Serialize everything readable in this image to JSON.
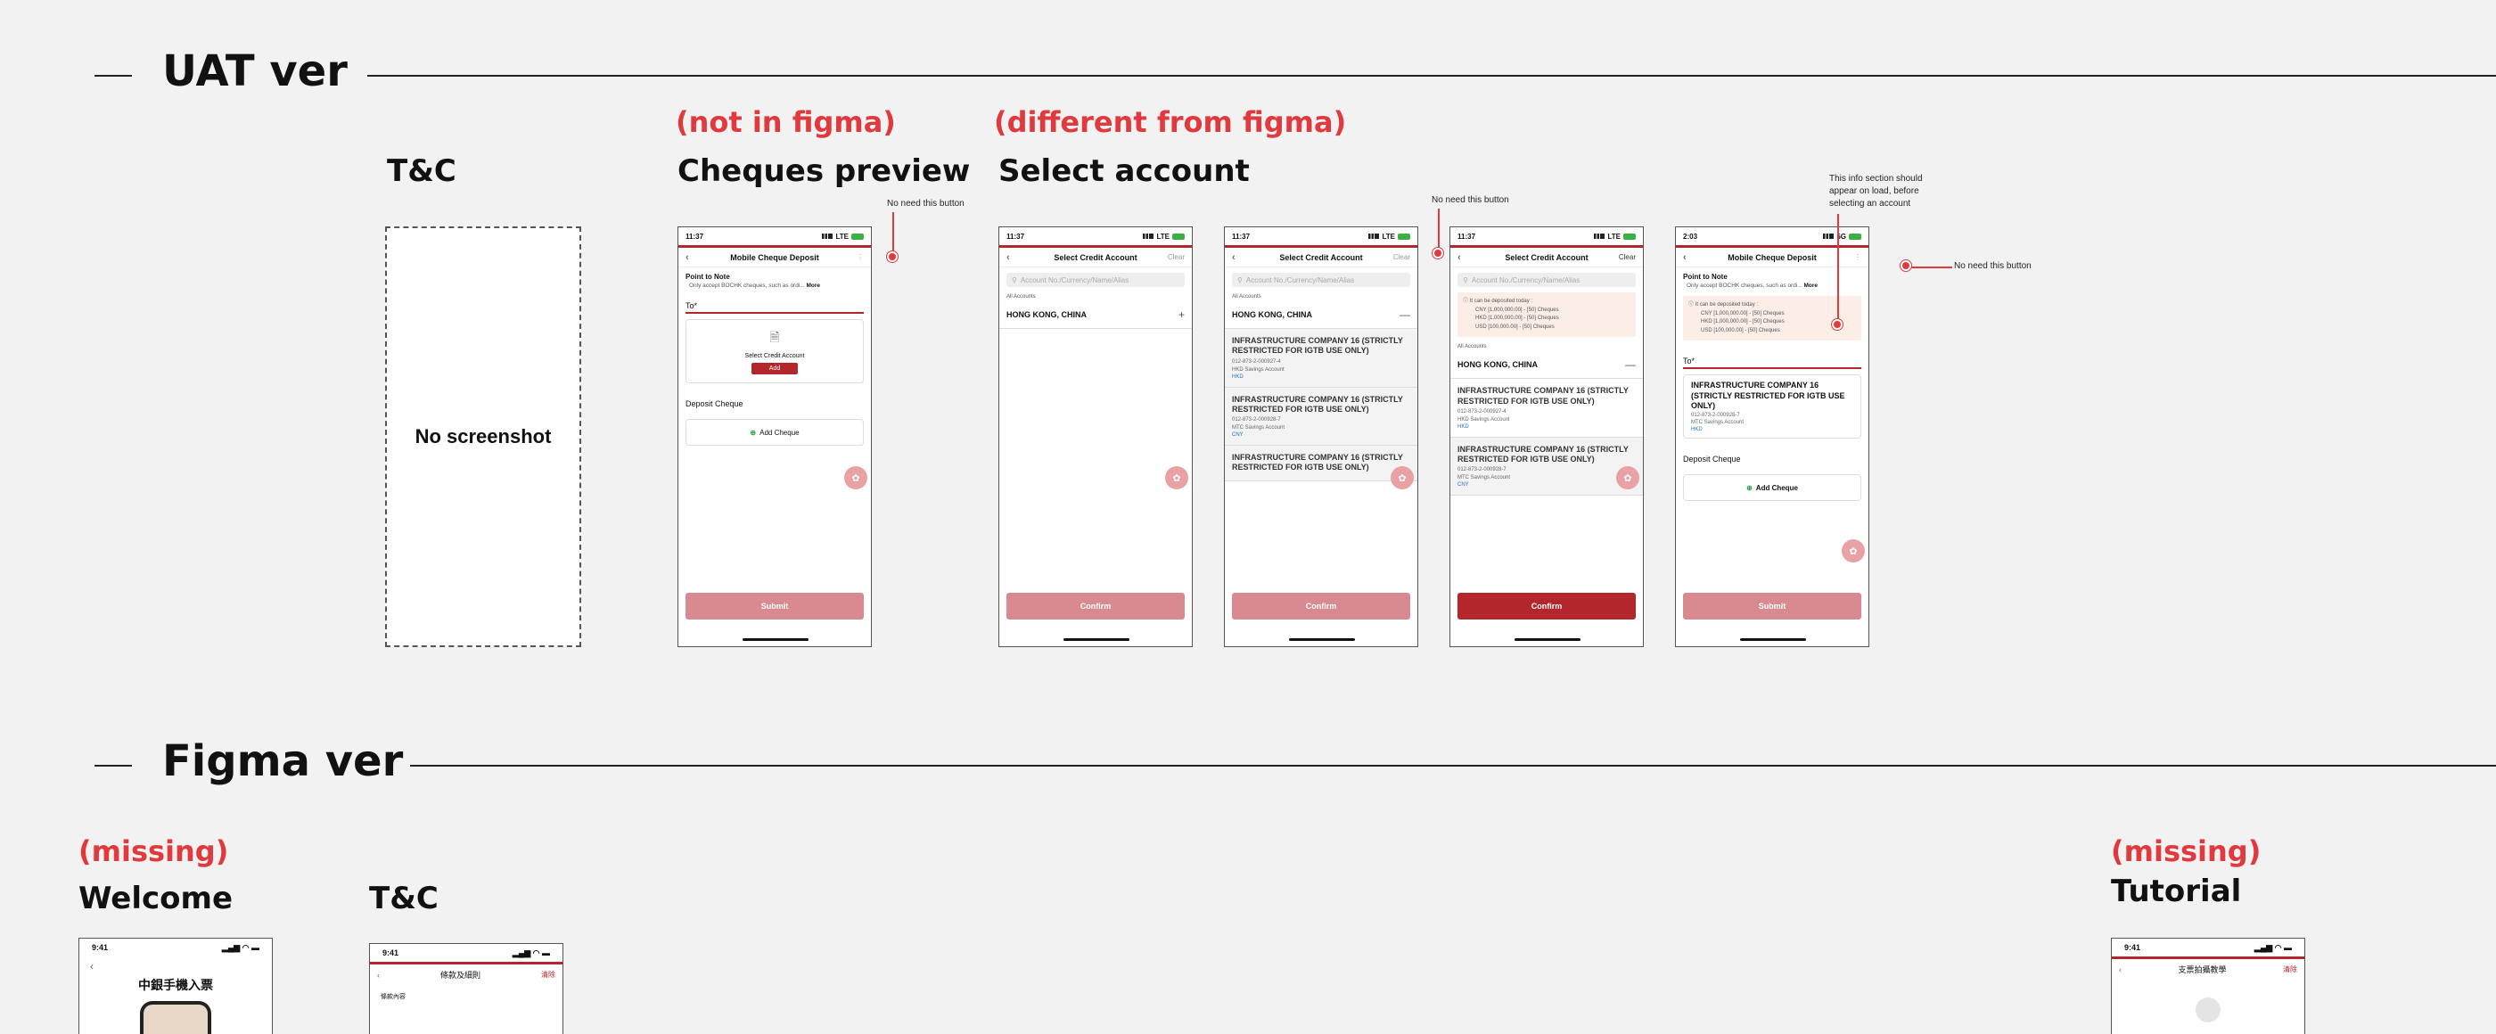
{
  "sections": {
    "uat": {
      "title": "UAT ver"
    },
    "figma": {
      "title": "Figma ver"
    }
  },
  "uat_frames": {
    "tnc": {
      "title": "T&C",
      "placeholder": "No screenshot"
    },
    "cheques_preview": {
      "flag": "(not in figma)",
      "title": "Cheques preview",
      "annotation": "No need this button",
      "screen": {
        "time": "11:37",
        "network": "LTE",
        "nav_title": "Mobile Cheque Deposit",
        "note_head": "Point to Note",
        "note_text": "Only accept BOCHK cheques, such as ordi...",
        "note_more": "More",
        "to_label": "To*",
        "select_label": "Select Credit Account",
        "add_label": "Add",
        "deposit_label": "Deposit Cheque",
        "add_cheque": "Add Cheque",
        "submit": "Submit"
      }
    },
    "select_account": {
      "flag": "(different from figma)",
      "title": "Select account",
      "annotation_mid": "No need this button",
      "annotation_right": "No need this button",
      "annotation_info": "This info section should appear on load, before selecting an account",
      "s1": {
        "time": "11:37",
        "network": "LTE",
        "nav_title": "Select Credit Account",
        "clear": "Clear",
        "search_placeholder": "Account No./Currency/Name/Alias",
        "all_accounts": "All Accounts",
        "region": "HONG KONG, CHINA",
        "confirm": "Confirm"
      },
      "s2": {
        "time": "11:37",
        "network": "LTE",
        "nav_title": "Select Credit Account",
        "clear": "Clear",
        "search_placeholder": "Account No./Currency/Name/Alias",
        "all_accounts": "All Accounts",
        "region": "HONG KONG, CHINA",
        "accounts": [
          {
            "name": "INFRASTRUCTURE COMPANY 16 (STRICTLY RESTRICTED FOR IGTB USE ONLY)",
            "num": "012-873-2-000927-4",
            "type": "HKD Savings Account",
            "cur": "HKD"
          },
          {
            "name": "INFRASTRUCTURE COMPANY 16 (STRICTLY RESTRICTED FOR IGTB USE ONLY)",
            "num": "012-873-2-000928-7",
            "type": "MTC Savings Account",
            "cur": "CNY"
          },
          {
            "name": "INFRASTRUCTURE COMPANY 16 (STRICTLY RESTRICTED FOR IGTB USE ONLY)",
            "num": "",
            "type": "",
            "cur": ""
          }
        ],
        "confirm": "Confirm"
      },
      "s3": {
        "time": "11:37",
        "network": "LTE",
        "nav_title": "Select Credit Account",
        "clear": "Clear",
        "search_placeholder": "Account No./Currency/Name/Alias",
        "info_head": "It can be deposited today :",
        "info_rows": [
          "CNY [1,000,000.00] - [50] Cheques",
          "HKD [1,000,000.00] - [50] Cheques",
          "USD [100,000.00] - [50] Cheques"
        ],
        "all_accounts": "All Accounts",
        "region": "HONG KONG, CHINA",
        "accounts": [
          {
            "name": "INFRASTRUCTURE COMPANY 16 (STRICTLY RESTRICTED FOR IGTB USE ONLY)",
            "num": "012-873-2-000927-4",
            "type": "HKD Savings Account",
            "cur": "HKD"
          },
          {
            "name": "INFRASTRUCTURE COMPANY 16 (STRICTLY RESTRICTED FOR IGTB USE ONLY)",
            "num": "012-873-2-000928-7",
            "type": "MTC Savings Account",
            "cur": "CNY"
          }
        ],
        "confirm": "Confirm"
      },
      "s4": {
        "time": "2:03",
        "network": "5G",
        "nav_title": "Mobile Cheque Deposit",
        "note_head": "Point to Note",
        "note_text": "Only accept BOCHK cheques, such as ordi...",
        "note_more": "More",
        "info_head": "It can be deposited today :",
        "info_rows": [
          "CNY [1,000,000.00] - [50] Cheques",
          "HKD [1,000,000.00] - [50] Cheques",
          "USD [100,000.00] - [50] Cheques"
        ],
        "to_label": "To*",
        "account": {
          "name": "INFRASTRUCTURE COMPANY 16 (STRICTLY RESTRICTED FOR IGTB USE ONLY)",
          "num": "012-873-2-000928-7",
          "type": "MTC Savings Account",
          "cur": "HKD"
        },
        "deposit_label": "Deposit Cheque",
        "add_cheque": "Add Cheque",
        "submit": "Submit"
      }
    }
  },
  "figma_frames": {
    "welcome": {
      "flag": "(missing)",
      "title": "Welcome",
      "time": "9:41",
      "heading": "中銀手機入票"
    },
    "tnc": {
      "title": "T&C",
      "time": "9:41",
      "nav_title": "條款及細則",
      "clear": "清除",
      "sub": "條款內容"
    },
    "tutorial": {
      "flag": "(missing)",
      "title": "Tutorial",
      "time": "9:41",
      "nav_title": "支票拍攝教學",
      "clear": "清除"
    }
  },
  "colors": {
    "accent_red": "#e03a3e",
    "brand_red": "#b3262b",
    "pale_red": "#d98a90"
  }
}
